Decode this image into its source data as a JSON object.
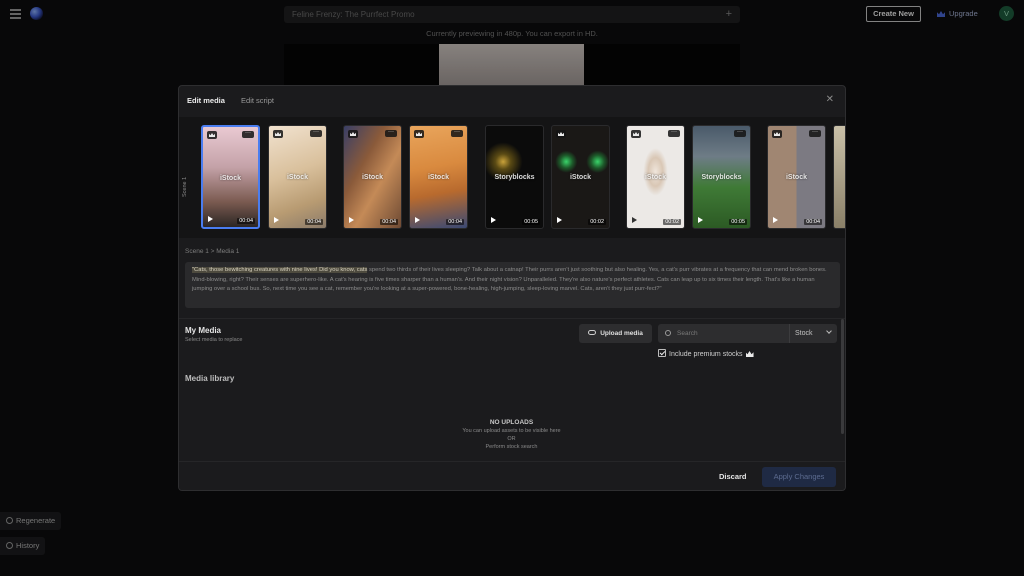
{
  "app": {
    "project_title": "Feline Frenzy: The Purrfect Promo",
    "create_new": "Create New",
    "upgrade": "Upgrade",
    "avatar_initial": "V",
    "preview_note": "Currently previewing in 480p. You can export in HD.",
    "side_buttons": {
      "regenerate": "Regenerate",
      "history": "History"
    }
  },
  "modal": {
    "tabs": [
      "Edit media",
      "Edit script"
    ],
    "scene_label": "Scene 1",
    "thumbnails": [
      {
        "source": "iStock",
        "duration": "00:04",
        "selected": true
      },
      {
        "source": "iStock",
        "duration": "00:04",
        "selected": false
      },
      {
        "source": "iStock",
        "duration": "00:04",
        "selected": false
      },
      {
        "source": "iStock",
        "duration": "00:04",
        "selected": false
      },
      {
        "source": "Storyblocks",
        "duration": "00:05",
        "selected": false
      },
      {
        "source": "iStock",
        "duration": "00:02",
        "selected": false
      },
      {
        "source": "iStock",
        "duration": "00:02",
        "selected": false
      },
      {
        "source": "Storyblocks",
        "duration": "00:05",
        "selected": false
      },
      {
        "source": "iStock",
        "duration": "00:04",
        "selected": false
      }
    ],
    "breadcrumb": "Scene 1 > Media 1",
    "script_highlight": "\"Cats, those bewitching creatures with nine lives! Did you know, cats",
    "script_rest": " spend two thirds of their lives sleeping? Talk about a catnap! Their purrs aren't just soothing but also healing. Yes, a cat's purr vibrates at a frequency that can mend broken bones. Mind-blowing, right? Their senses are superhero-like. A cat's hearing is five times sharper than a human's. And their night vision? Unparalleled. They're also nature's perfect athletes. Cats can leap up to six times their length. That's like a human jumping over a school bus. So, next time you see a cat, remember you're looking at a super-powered, bone-healing, high-jumping, sleep-loving marvel. Cats, aren't they just purr-fect?\"",
    "my_media": {
      "title": "My Media",
      "subtitle": "Select media to replace",
      "upload_button": "Upload media",
      "search_placeholder": "Search",
      "source_select": "Stock",
      "premium_label": "Include premium stocks"
    },
    "media_library": {
      "title": "Media library",
      "empty_title": "NO UPLOADS",
      "empty_line1": "You can upload assets to be visible here",
      "empty_or": "OR",
      "empty_line2": "Perform stock search"
    },
    "footer": {
      "discard": "Discard",
      "apply": "Apply Changes"
    }
  }
}
